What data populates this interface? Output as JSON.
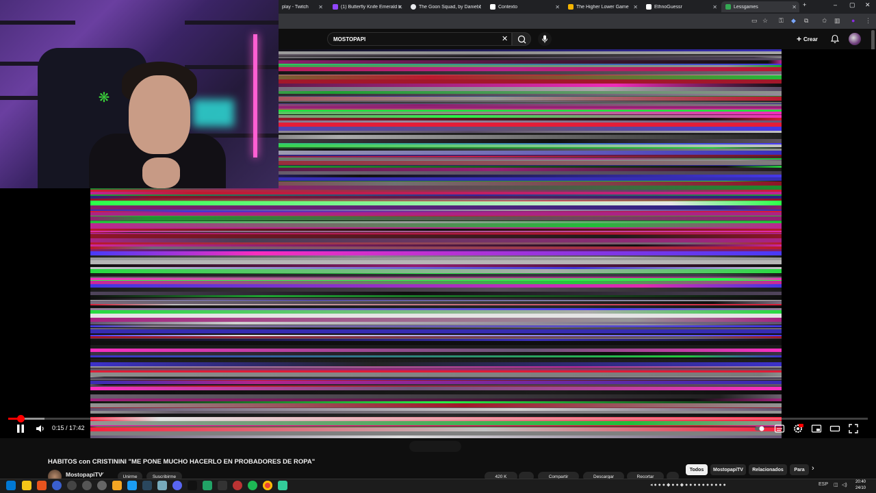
{
  "browser": {
    "tabs": [
      {
        "title": "play - Twitch",
        "favicon_color": "#9146ff"
      },
      {
        "title": "(1) Butterfly Knife Emerald tr...",
        "favicon_color": "#9146ff"
      },
      {
        "title": "The Goon Squad, by Daniel B...",
        "favicon_color": "#e8eaed"
      },
      {
        "title": "Contexto",
        "favicon_color": "#ffffff"
      },
      {
        "title": "The Higher Lower Game",
        "favicon_color": "#f4b400"
      },
      {
        "title": "EthnoGuessr",
        "favicon_color": "#ffffff"
      },
      {
        "title": "Lessgames",
        "favicon_color": "#34a853"
      }
    ],
    "new_tab_icon": "plus-icon",
    "window_controls": [
      "chevron-down-icon",
      "minimize-icon",
      "restore-icon",
      "close-icon"
    ]
  },
  "youtube": {
    "search_value": "MOSTOPAPI",
    "create_label": "Crear",
    "video": {
      "current_time": "0:15",
      "duration": "17:42",
      "time_display": "0:15 / 17:42",
      "progress_fraction": 0.014,
      "buffer_fraction": 0.042,
      "title": "HABITOS con CRISTININI \"ME PONE MUCHO HACERLO EN PROBADORES DE ROPA\"",
      "channel": "MostopapiTV"
    },
    "action_pills": [
      "Unirme",
      "Suscribirme",
      "420 K",
      "",
      "Compartir",
      "Descargar",
      "Recortar",
      ""
    ],
    "chips": [
      {
        "label": "Todos",
        "active": true
      },
      {
        "label": "MostopapiTV",
        "active": false
      },
      {
        "label": "Relacionados",
        "active": false
      },
      {
        "label": "Para",
        "active": false
      }
    ]
  },
  "taskbar": {
    "tray_lang": "ESP",
    "clock_time": "20:40",
    "clock_date": "24/10"
  }
}
